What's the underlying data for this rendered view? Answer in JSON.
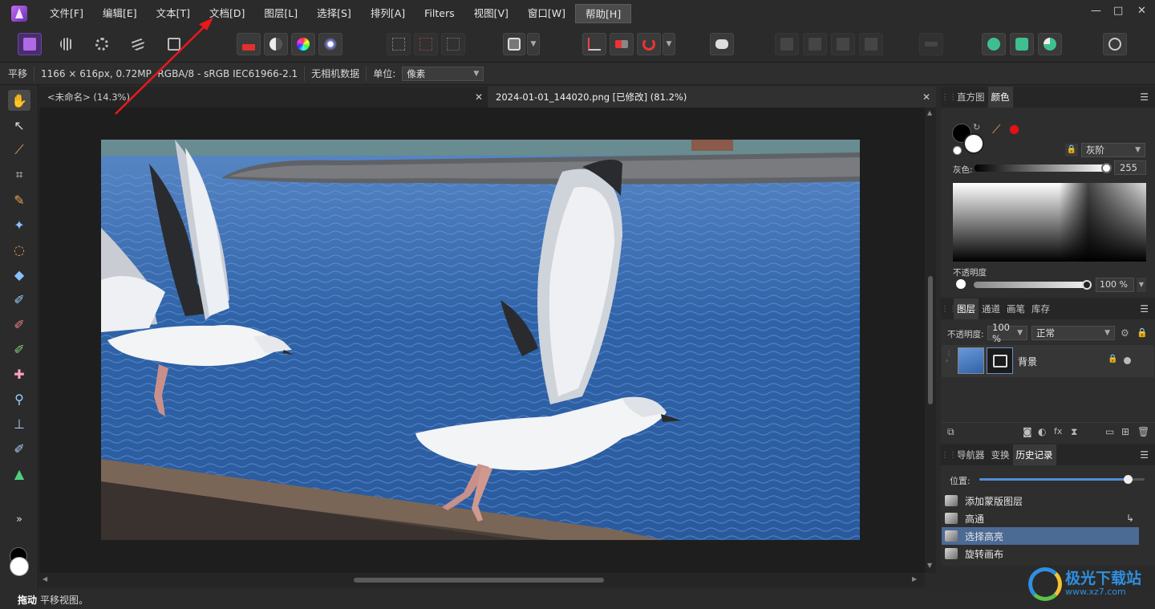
{
  "menu": {
    "items": [
      "文件[F]",
      "编辑[E]",
      "文本[T]",
      "文档[D]",
      "图层[L]",
      "选择[S]",
      "排列[A]",
      "Filters",
      "视图[V]",
      "窗口[W]",
      "帮助[H]"
    ]
  },
  "window_controls": {
    "minimize": "—",
    "maximize": "□",
    "close": "✕"
  },
  "context_bar": {
    "tool_name": "平移",
    "image_info": "1166 × 616px, 0.72MP, RGBA/8 - sRGB IEC61966-2.1",
    "camera": "无相机数据",
    "unit_label": "单位:",
    "unit_value": "像素"
  },
  "tools": {
    "more": "»"
  },
  "document_tabs": [
    {
      "title": "<未命名> (14.3%)",
      "close": "✕"
    },
    {
      "title": "2024-01-01_144020.png [已修改] (81.2%)",
      "close": "✕"
    }
  ],
  "color_panel": {
    "tabs": [
      "直方图",
      "颜色"
    ],
    "mode": "灰阶",
    "gray_label": "灰色:",
    "gray_value": "255",
    "opacity_label": "不透明度",
    "opacity_value": "100 %",
    "accent_color": "#e81010"
  },
  "layers_panel": {
    "tabs": [
      "图层",
      "通道",
      "画笔",
      "库存"
    ],
    "opacity_label": "不透明度:",
    "opacity_value": "100 %",
    "blend_mode": "正常",
    "layer_name": "背景"
  },
  "history_panel": {
    "tabs": [
      "导航器",
      "变换",
      "历史记录"
    ],
    "position_label": "位置:",
    "position_fraction": 0.9,
    "items": [
      "添加蒙版图层",
      "高通",
      "选择高亮",
      "旋转画布"
    ],
    "selected_index": 2
  },
  "status_bar": {
    "action": "拖动",
    "message": "平移视图。"
  },
  "watermark": {
    "title": "极光下载站",
    "url": "www.xz7.com"
  }
}
